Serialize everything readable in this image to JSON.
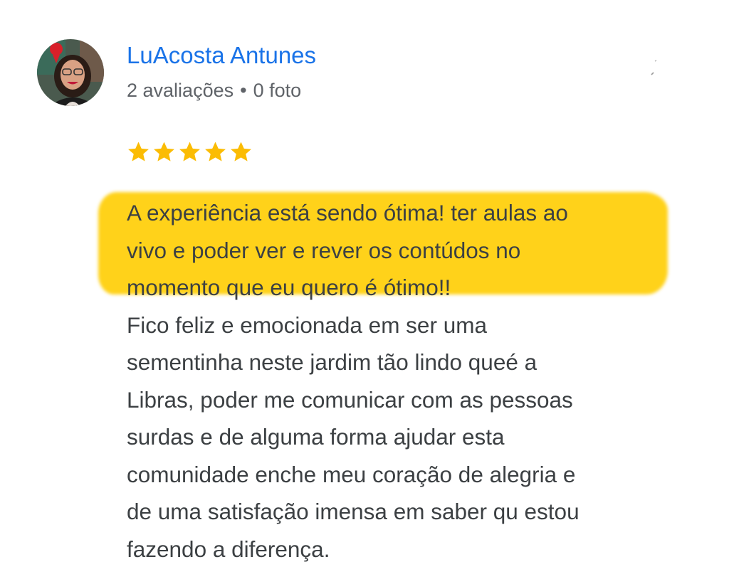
{
  "review": {
    "author": {
      "name": "LuAcosta Antunes",
      "reviews_count": "2 avaliações",
      "separator": "•",
      "photos_count": "0 foto",
      "avatar": "profile-photo"
    },
    "rating": {
      "value": 5,
      "max": 5,
      "color": "#fbbc04"
    },
    "highlighted_text_lines": [
      "A experiência está sendo ótima! ter aulas ao",
      "vivo e poder ver e rever os contúdos no",
      "momento que eu quero é ótimo!!"
    ],
    "body_text_lines": [
      "Fico feliz e emocionada em ser uma",
      "sementinha neste jardim tão lindo queé a",
      "Libras, poder me comunicar com as pessoas",
      "surdas e de alguma forma ajudar esta",
      "comunidade enche meu coração de alegria e",
      "de uma satisfação imensa em saber qu estou",
      "fazendo a diferença."
    ]
  },
  "colors": {
    "name": "#1a73e8",
    "meta": "#5f6368",
    "text": "#3c4043",
    "highlight": "#ffd21a"
  }
}
